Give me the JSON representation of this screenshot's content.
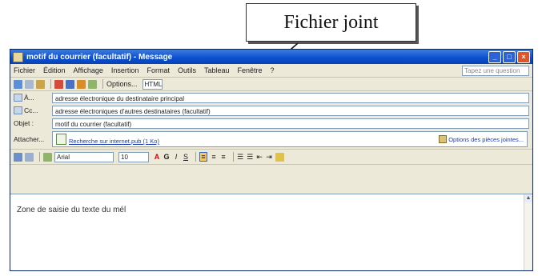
{
  "callout": {
    "label": "Fichier joint"
  },
  "window": {
    "title": "motif du courrier (facultatif) - Message",
    "controls": {
      "minimize": "_",
      "maximize": "□",
      "close": "×"
    }
  },
  "menubar": {
    "items": [
      "Fichier",
      "Édition",
      "Affichage",
      "Insertion",
      "Format",
      "Outils",
      "Tableau",
      "Fenêtre",
      "?"
    ],
    "help_placeholder": "Tapez une question"
  },
  "toolbar": {
    "options_label": "Options...",
    "format_value": "HTML"
  },
  "header": {
    "to_label": "À...",
    "to_value": "adresse électronique du destinataire principal",
    "cc_label": "Cc...",
    "cc_value": "adresse électroniques d'autres destinataires (facultatif)",
    "subject_label": "Objet :",
    "subject_value": "motif du courrier (facultatif)",
    "attach_label": "Attacher...",
    "attach_file": "Recherche sur internet.pub (1 Ko)",
    "attach_options": "Options des pièces jointes..."
  },
  "formatting": {
    "font": "Arial",
    "size": "10"
  },
  "body": {
    "placeholder_text": "Zone de saisie du texte du mél"
  },
  "colors": {
    "title_bar": "#0a4fd0",
    "chrome": "#ece9d8",
    "field_border": "#7f9db9",
    "link": "#1a3cab"
  }
}
